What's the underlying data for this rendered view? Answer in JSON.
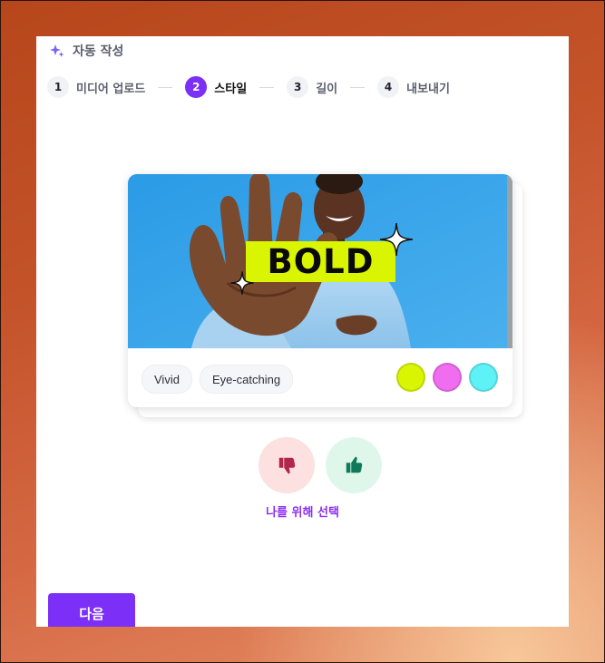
{
  "header": {
    "title": "자동 작성",
    "icon": "sparkle-icon"
  },
  "steps": [
    {
      "num": "1",
      "label": "미디어 업로드",
      "active": false
    },
    {
      "num": "2",
      "label": "스타일",
      "active": true
    },
    {
      "num": "3",
      "label": "길이",
      "active": false
    },
    {
      "num": "4",
      "label": "내보내기",
      "active": false
    }
  ],
  "card": {
    "overlay_text": "BOLD",
    "tags": [
      "Vivid",
      "Eye-catching"
    ],
    "swatches": [
      "#d9f502",
      "#f06df0",
      "#5ef2f7"
    ]
  },
  "vote": {
    "dislike_icon": "thumbs-down-icon",
    "like_icon": "thumbs-up-icon"
  },
  "pick_label": "나를 위해 선택",
  "next_button": "다음",
  "colors": {
    "accent": "#7b2ff7",
    "accent_text": "#8b2ff0"
  }
}
